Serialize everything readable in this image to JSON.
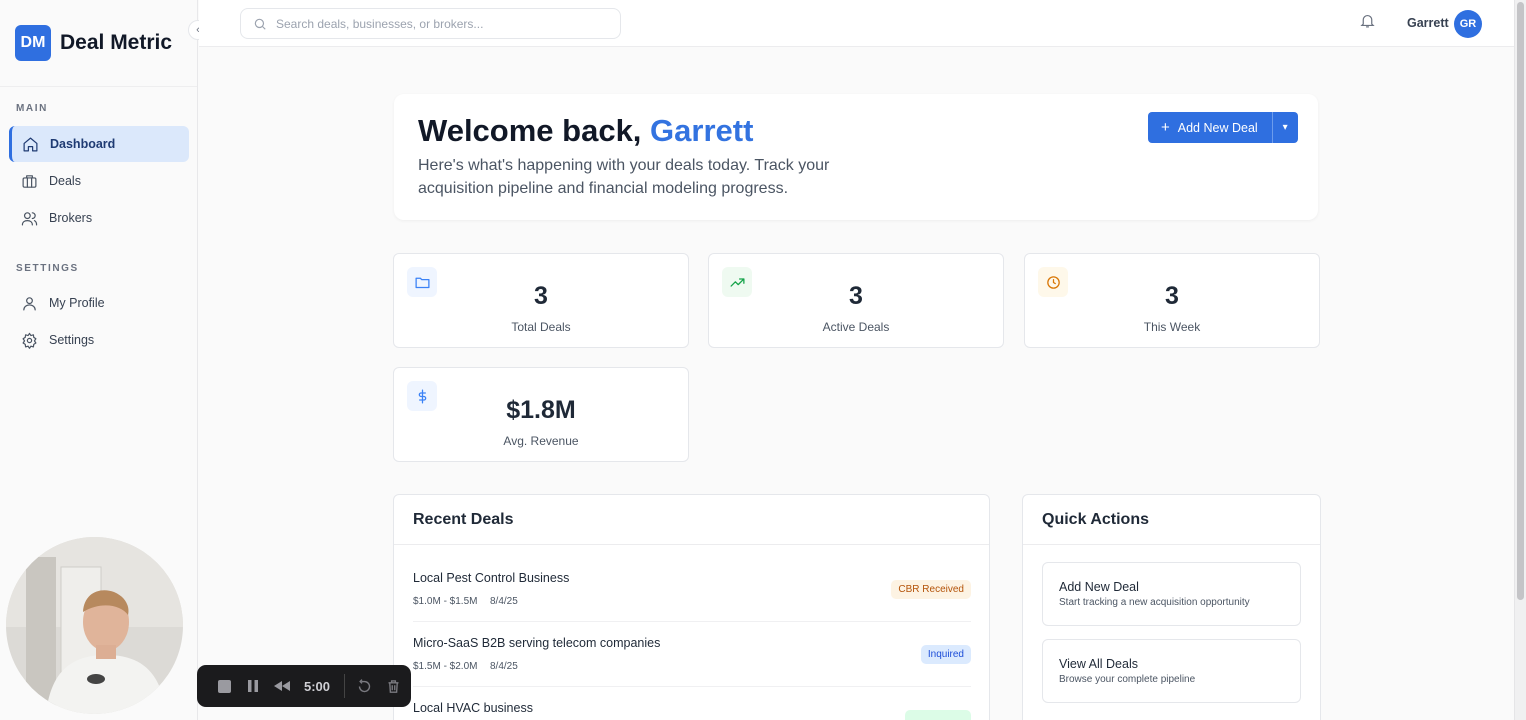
{
  "brand": {
    "logo": "DM",
    "name": "Deal Metric"
  },
  "sidebar": {
    "main_label": "MAIN",
    "settings_label": "SETTINGS",
    "main_items": [
      {
        "label": "Dashboard",
        "icon": "home-icon",
        "active": true
      },
      {
        "label": "Deals",
        "icon": "briefcase-icon"
      },
      {
        "label": "Brokers",
        "icon": "users-icon"
      }
    ],
    "settings_items": [
      {
        "label": "My Profile",
        "icon": "user-icon"
      },
      {
        "label": "Settings",
        "icon": "gear-icon"
      }
    ]
  },
  "topbar": {
    "search_placeholder": "Search deals, businesses, or brokers...",
    "user_name": "Garrett",
    "avatar_initials": "GR"
  },
  "welcome": {
    "greeting": "Welcome back,",
    "name": "Garrett",
    "subtitle": "Here's what's happening with your deals today. Track your acquisition pipeline and financial modeling progress.",
    "add_button": "Add New Deal"
  },
  "stats": [
    {
      "value": "3",
      "label": "Total Deals",
      "icon": "folder-icon",
      "color": "#3b82f6"
    },
    {
      "value": "3",
      "label": "Active Deals",
      "icon": "trending-up-icon",
      "color": "#16a34a"
    },
    {
      "value": "3",
      "label": "This Week",
      "icon": "clock-icon",
      "color": "#d97706"
    },
    {
      "value": "$1.8M",
      "label": "Avg. Revenue",
      "icon": "dollar-icon",
      "color": "#3b82f6"
    }
  ],
  "recent_deals": {
    "title": "Recent Deals",
    "items": [
      {
        "name": "Local Pest Control Business",
        "range": "$1.0M - $1.5M",
        "date": "8/4/25",
        "status": "CBR Received",
        "status_color": "#b45309",
        "status_bg": "#fdf3e3"
      },
      {
        "name": "Micro-SaaS B2B serving telecom companies",
        "range": "$1.5M - $2.0M",
        "date": "8/4/25",
        "status": "Inquired",
        "status_color": "#1d4ed8",
        "status_bg": "#dbeafe"
      },
      {
        "name": "Local HVAC business",
        "range": "",
        "date": "",
        "status": "",
        "status_color": "#15803d",
        "status_bg": "#dcfce7"
      }
    ]
  },
  "quick_actions": {
    "title": "Quick Actions",
    "items": [
      {
        "title": "Add New Deal",
        "subtitle": "Start tracking a new acquisition opportunity"
      },
      {
        "title": "View All Deals",
        "subtitle": "Browse your complete pipeline"
      }
    ]
  },
  "recorder": {
    "time": "5:00"
  }
}
